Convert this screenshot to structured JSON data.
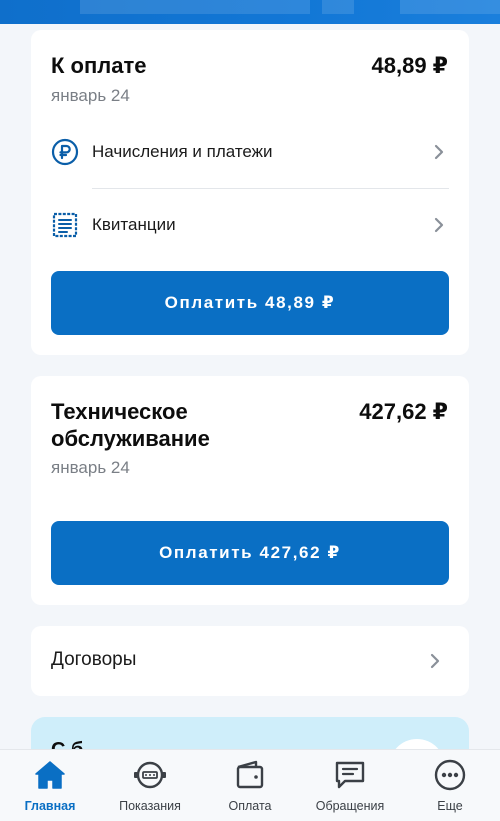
{
  "colors": {
    "accent": "#0a6fc4",
    "icon": "#0a5ea8",
    "muted": "#7a7f86",
    "tab_icon": "#3b4046"
  },
  "payment_card": {
    "title": "К оплате",
    "amount": "48,89 ₽",
    "period": "январь 24",
    "rows": [
      {
        "label": "Начисления и платежи",
        "icon": "ruble-circle-icon"
      },
      {
        "label": "Квитанции",
        "icon": "receipt-icon"
      }
    ],
    "pay_button": "Оплатить 48,89 ₽"
  },
  "tech_card": {
    "title_line1": "Техническое",
    "title_line2": "обслуживание",
    "amount": "427,62 ₽",
    "period": "январь 24",
    "pay_button": "Оплатить 427,62 ₽"
  },
  "contracts": {
    "label": "Договоры"
  },
  "promo": {
    "text": "С б"
  },
  "tabbar": {
    "tabs": [
      {
        "label": "Главная",
        "icon": "home-icon",
        "active": true
      },
      {
        "label": "Показания",
        "icon": "meter-icon",
        "active": false
      },
      {
        "label": "Оплата",
        "icon": "wallet-icon",
        "active": false
      },
      {
        "label": "Обращения",
        "icon": "chat-icon",
        "active": false
      },
      {
        "label": "Еще",
        "icon": "more-icon",
        "active": false
      }
    ]
  }
}
